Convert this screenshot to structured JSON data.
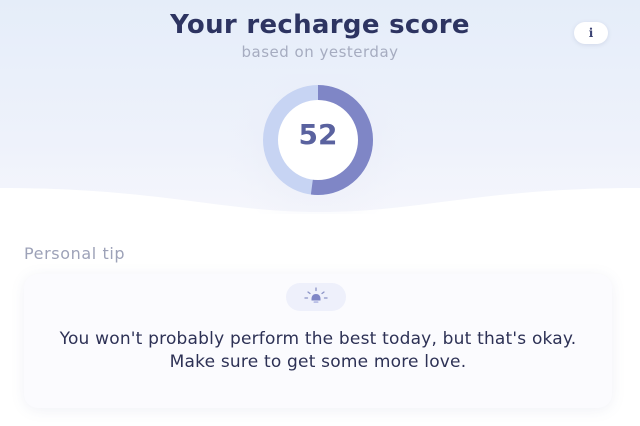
{
  "header": {
    "title": "Your recharge score",
    "subtitle": "based on yesterday",
    "info_label": "i"
  },
  "score": {
    "value": "52",
    "fraction": 0.52,
    "ring_color": "#7f86c6",
    "track_color": "#c7d4f3"
  },
  "tip": {
    "title": "Personal tip",
    "icon": "lightbulb-icon",
    "text": "You won't probably perform the best today, but that's okay. Make sure to get some more love."
  },
  "colors": {
    "accent": "#2d3461",
    "muted": "#a6acc0"
  }
}
